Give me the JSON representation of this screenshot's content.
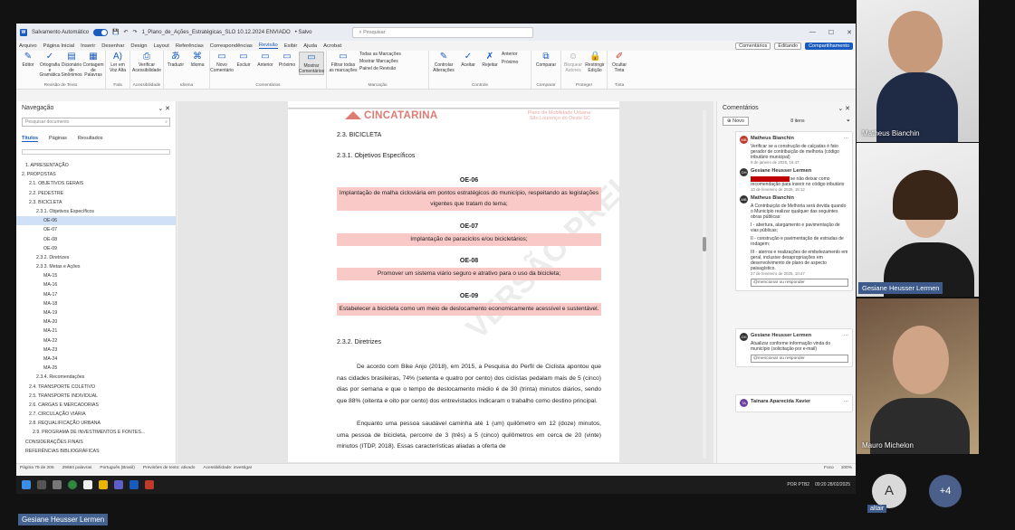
{
  "titlebar": {
    "autosave": "Salvamento Automático",
    "doc_title": "1_Plano_de_Ações_Estratégicas_SLO 10.12.2024 ENVIADO",
    "saved": "• Salvo",
    "search_placeholder": "Pesquisar"
  },
  "menu": {
    "items": [
      "Arquivo",
      "Página Inicial",
      "Inserir",
      "Desenhar",
      "Design",
      "Layout",
      "Referências",
      "Correspondências",
      "Revisão",
      "Exibir",
      "Ajuda",
      "Acrobat"
    ],
    "comments_btn": "Comentários",
    "editing_btn": "Editando",
    "share_btn": "Compartilhamento"
  },
  "ribbon": {
    "groups": [
      {
        "label": "Revisão de Texto",
        "buttons": [
          "Editor",
          "Ortografia e Gramática",
          "Dicionário de Sinônimos",
          "Contagem de Palavras"
        ]
      },
      {
        "label": "Fala",
        "buttons": [
          "Ler em Voz Alta"
        ]
      },
      {
        "label": "Acessibilidade",
        "buttons": [
          "Verificar Acessibilidade"
        ]
      },
      {
        "label": "Idioma",
        "buttons": [
          "Traduzir",
          "Idioma"
        ]
      },
      {
        "label": "Comentários",
        "buttons": [
          "Novo Comentário",
          "Excluir",
          "Anterior",
          "Próximo",
          "Mostrar Comentários"
        ]
      },
      {
        "label": "Marcação",
        "buttons": [
          "Filtrar todas as marcações",
          "Todas as Marcações",
          "Mostrar Marcações",
          "Painel de Revisão"
        ]
      },
      {
        "label": "Controle",
        "buttons": [
          "Controlar Alterações",
          "Aceitar",
          "Rejeitar",
          "Anterior",
          "Próximo"
        ]
      },
      {
        "label": "Comparar",
        "buttons": [
          "Comparar"
        ]
      },
      {
        "label": "Proteger",
        "buttons": [
          "Bloquear Autores",
          "Restringir Edição"
        ]
      },
      {
        "label": "Tinta",
        "buttons": [
          "Ocultar Tinta"
        ]
      }
    ]
  },
  "nav": {
    "title": "Navegação",
    "search_placeholder": "Pesquisar documento",
    "tabs": [
      "Títulos",
      "Páginas",
      "Resultados"
    ],
    "items": [
      "1. APRESENTAÇÃO",
      "2. PROPOSTAS",
      "2.1. OBJETIVOS GERAIS",
      "2.2. PEDESTRE",
      "2.3. BICICLETA",
      "2.3.1. Objetivos Específicos",
      "OE-06",
      "OE-07",
      "OE-08",
      "OE-09",
      "2.3.2. Diretrizes",
      "2.3.3. Metas e Ações",
      "MA-15",
      "MA-16",
      "MA-17",
      "MA-18",
      "MA-19",
      "MA-20",
      "MA-21",
      "MA-22",
      "MA-23",
      "MA-24",
      "MA-25",
      "2.3.4. Recomendações",
      "2.4. TRANSPORTE COLETIVO",
      "2.5. TRANSPORTE INDIVIDUAL",
      "2.6. CARGAS E MERCADORIAS",
      "2.7. CIRCULAÇÃO VIÁRIA",
      "2.8. REQUALIFICAÇÃO URBANA",
      "2.9. PROGRAMA DE INVESTIMENTOS E FONTES...",
      "CONSIDERAÇÕES FINAIS",
      "REFERÊNCIAS BIBLIOGRÁFICAS"
    ]
  },
  "page": {
    "logo": "CINCATARINA",
    "header_right_1": "Plano de Mobilidade Urbana",
    "header_right_2": "São Lourenço do Oeste SC",
    "watermark": "VERSÃO PRELIMINAR",
    "h_section": "2.3.     BICICLETA",
    "h_sub1": "2.3.1.  Objetivos Específicos",
    "oe": [
      {
        "title": "OE-06",
        "text": "Implantação de malha cicloviária em pontos estratégicos do município, respeitando as legislações vigentes que tratam do tema;"
      },
      {
        "title": "OE-07",
        "text": "Implantação de paraciclos e/ou bicicletários;"
      },
      {
        "title": "OE-08",
        "text": "Promover um sistema viário seguro e atrativo para o uso da bicicleta;"
      },
      {
        "title": "OE-09",
        "text": "Estabelecer a bicicleta como um meio de deslocamento economicamente acessível e sustentável."
      }
    ],
    "h_sub2": "2.3.2.  Diretrizes",
    "para1": "De acordo com Bike Anjo (2018), em 2015, a Pesquisa do Perfil de Ciclista apontou que nas cidades brasileiras, 74% (setenta e quatro por cento) dos ciclistas pedalam mais de 5 (cinco) dias por semana e que o tempo de deslocamento médio é de 30 (trinta) minutos diários, sendo que 88% (oitenta e oito por cento) dos entrevistados indicaram o trabalho como destino principal.",
    "para2": "Enquanto uma pessoa saudável caminha até 1 (um) quilômetro em 12 (doze) minutos, uma pessoa de bicicleta, percorre de 3 (três) a 5 (cinco) quilômetros em cerca de 20 (vinte) minutos (ITDP, 2018). Essas características aliadas a oferta de"
  },
  "comments": {
    "title": "Comentários",
    "new_btn": "Novo",
    "count": "8 itens",
    "cards": [
      {
        "entries": [
          {
            "author": "Matheus Bianchin",
            "initials": "MB",
            "text": "Verificar se a construção de calçadas é fato gerador de contribuição de melhoria (código tributário municipal)",
            "date": "9 de janeiro de 2025, 16:47"
          },
          {
            "author": "Gesiane Heusser Lermen",
            "initials": "GH",
            "text_hl": "xxxxxxxxxxxxxxxxx",
            "text": " se não deixar como recomendação para inserir no código tributário",
            "date": "10 de fevereiro de 2025, 15:12"
          },
          {
            "author": "Matheus Bianchin",
            "initials": "MB",
            "text": "A Contribuição de Melhoria será devida quando o Município realizar qualquer das seguintes obras públicas:",
            "items": [
              "I - abertura, alargamento e pavimentação de vias públicas;",
              "II - construção e pavimentação de estradas de rodagem;",
              "III - aterros e realizações de embelezamento em geral, inclusive desapropriações em desenvolvimento de plano de aspecto paisagístico."
            ],
            "date": "27 de fevereiro de 2025, 10:47"
          }
        ],
        "reply": "@mencionar ou responder"
      },
      {
        "entries": [
          {
            "author": "Gesiane Heusser Lermen",
            "initials": "GH",
            "text": "Atualizar conforme informação vinda do município (solicitação por e-mail)",
            "date": ""
          }
        ],
        "reply": "@mencionar ou responder"
      },
      {
        "entries": [
          {
            "author": "Tainara Aparecida Xavier",
            "initials": "TA",
            "text": "",
            "date": ""
          }
        ]
      }
    ]
  },
  "status": {
    "page": "Página 79 de 206",
    "words": "29684 palavras",
    "lang": "Português (Brasil)",
    "prediction": "Previsões de texto: ativado",
    "accessibility": "Acessibilidade: investigar",
    "focus": "Foco",
    "zoom": "100%"
  },
  "taskbar": {
    "lang": "POR PTB2",
    "time": "09:20",
    "date": "28/02/2025"
  },
  "video": {
    "p1": "Matheus Bianchin",
    "p2": "Gesiane Heusser Lermen",
    "p3": "Mauro Michelon",
    "a_initial": "A",
    "a_name": "altair",
    "more": "+4",
    "bottom_name": "Gesiane Heusser Lermen"
  },
  "colors": {
    "word_blue": "#185abd",
    "highlight": "#f8c9c6",
    "logo": "#e07b73"
  }
}
